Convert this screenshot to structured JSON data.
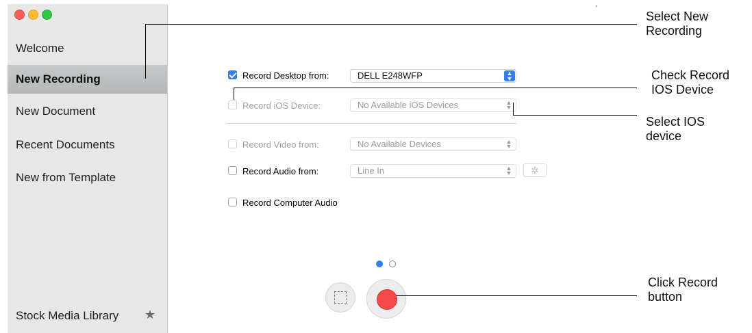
{
  "window": {
    "traffic_lights": [
      "close",
      "minimize",
      "zoom"
    ]
  },
  "sidebar": {
    "items": [
      {
        "label": "Welcome",
        "active": false
      },
      {
        "label": "New Recording",
        "active": true
      },
      {
        "label": "New Document",
        "active": false
      },
      {
        "label": "Recent Documents",
        "active": false
      },
      {
        "label": "New from Template",
        "active": false
      }
    ],
    "footer_label": "Stock Media Library",
    "footer_icon": "star-icon",
    "active_color": "#b9bdbd"
  },
  "main": {
    "record_desktop": {
      "label": "Record Desktop from:",
      "checked": true,
      "value": "DELL E248WFP"
    },
    "record_ios": {
      "label": "Record iOS Device:",
      "checked": false,
      "enabled": false,
      "value": "No Available iOS Devices"
    },
    "record_video": {
      "label": "Record Video from:",
      "checked": false,
      "enabled": false,
      "value": "No Available Devices"
    },
    "record_audio": {
      "label": "Record Audio from:",
      "checked": false,
      "value": "Line In",
      "settings_icon": "gear-icon"
    },
    "record_computer_audio": {
      "label": "Record Computer Audio",
      "checked": false
    },
    "page_dots": {
      "count": 2,
      "current": 1
    },
    "buttons": {
      "area_select_icon": "dashed-rectangle-icon",
      "record_icon": "record-icon",
      "record_color": "#f6474b"
    },
    "accent_color": "#2f7ff5"
  },
  "callouts": {
    "select_new_recording": "Select New\nRecording",
    "check_record_ios": "Check Record\nIOS Device",
    "select_ios_device": "Select IOS\ndevice",
    "click_record": "Click Record\nbutton"
  }
}
